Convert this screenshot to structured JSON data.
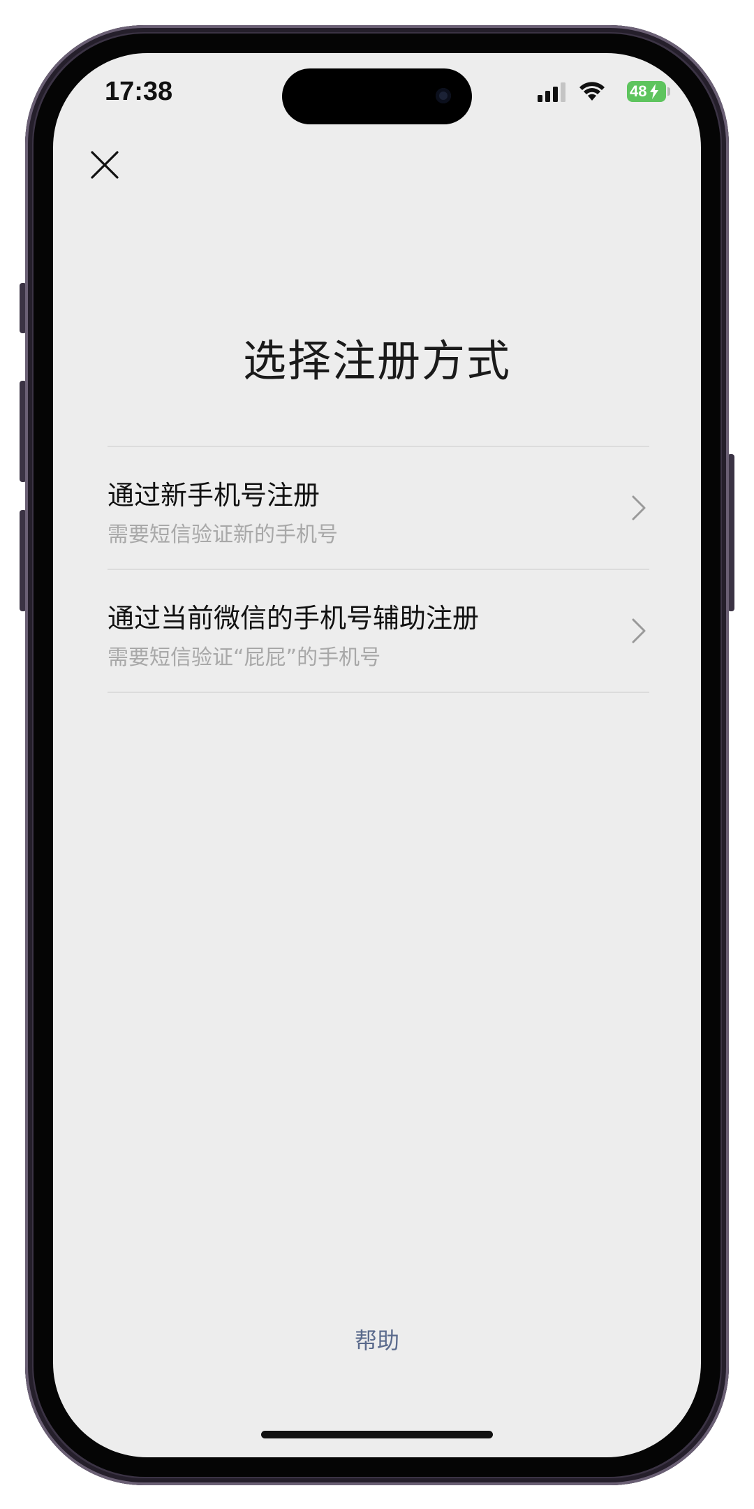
{
  "status_bar": {
    "time": "17:38",
    "battery_level": "48",
    "icons": [
      "signal-icon",
      "wifi-icon",
      "battery-icon"
    ]
  },
  "header": {
    "close_icon": "close-icon",
    "title": "选择注册方式"
  },
  "options": [
    {
      "title": "通过新手机号注册",
      "subtitle": "需要短信验证新的手机号"
    },
    {
      "title": "通过当前微信的手机号辅助注册",
      "subtitle": "需要短信验证“屁屁”的手机号"
    }
  ],
  "footer": {
    "help_label": "帮助"
  },
  "colors": {
    "screen_background": "#ededed",
    "help_link": "#5a6a8c",
    "battery": "#5ec45e",
    "subtitle": "#a8a8a8"
  }
}
